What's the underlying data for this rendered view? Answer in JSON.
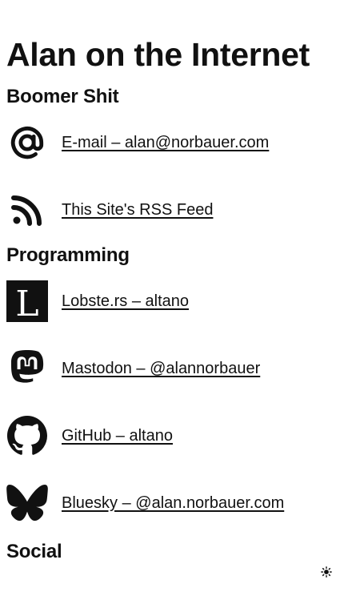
{
  "page": {
    "title": "Alan on the Internet"
  },
  "sections": {
    "boomer": {
      "heading": "Boomer Shit",
      "links": [
        {
          "icon": "at-sign-icon",
          "label": "E-mail – alan@norbauer.com"
        },
        {
          "icon": "rss-icon",
          "label": "This Site's RSS Feed"
        }
      ]
    },
    "programming": {
      "heading": "Programming",
      "links": [
        {
          "icon": "lobsters-icon",
          "label": "Lobste.rs – altano"
        },
        {
          "icon": "mastodon-icon",
          "label": "Mastodon – @alannorbauer"
        },
        {
          "icon": "github-icon",
          "label": "GitHub – altano"
        },
        {
          "icon": "bluesky-icon",
          "label": "Bluesky – @alan.norbauer.com"
        }
      ]
    },
    "social": {
      "heading": "Social"
    }
  },
  "theme_toggle": {
    "icon": "sun-icon"
  },
  "colors": {
    "text": "#111111",
    "background": "#ffffff"
  }
}
